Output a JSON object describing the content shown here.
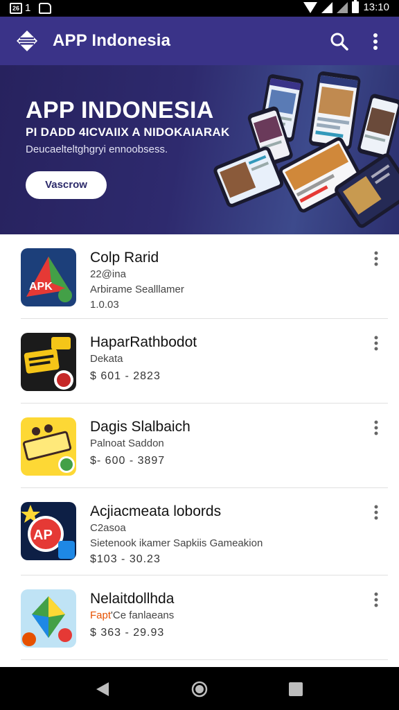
{
  "status_bar": {
    "left_badge": "26",
    "left_count": "1",
    "time": "13:10"
  },
  "app_bar": {
    "title": "APP Indonesia",
    "icons": [
      "app-logo-icon",
      "search-icon",
      "more-vert-icon"
    ]
  },
  "banner": {
    "title": "APP INDONESIA",
    "subtitle": "PI DADD 4ICVAIIX A NIDOKAIARAK",
    "description": "Deucaelteltghgryi ennoobsess.",
    "button_label": "Vascrow"
  },
  "apps": [
    {
      "name": "Colp Rarid",
      "line1": "22@ina",
      "line2": "Arbirame Sealllamer",
      "line3": "1.0.03",
      "icon": "app-triangle-icon",
      "icon_colors": [
        "#1c3f7a",
        "#e53935",
        "#43a047"
      ]
    },
    {
      "name": "HaparRathbodot",
      "line1": "Dekata",
      "price": "$ 601 - 2823",
      "icon": "app-badge-icon",
      "icon_colors": [
        "#1b1b1b",
        "#f5c518",
        "#c62828"
      ]
    },
    {
      "name": "Dagis Slalbaich",
      "line1": "Palnoat Saddon",
      "price": "$- 600 - 3897",
      "icon": "app-ticket-icon",
      "icon_colors": [
        "#fdd835",
        "#3e2723",
        "#43a047"
      ]
    },
    {
      "name": "Acjiacmeata  lobords",
      "line1": "C2asoa",
      "line2": "Sietenook ikamer Sapkiis Gameakion",
      "price": "$103 - 30.23",
      "icon": "app-ap-icon",
      "icon_colors": [
        "#0d1f45",
        "#e53935",
        "#1e88e5"
      ]
    },
    {
      "name": "Nelaitdollhda",
      "line1_accent": "Fapt",
      "line1_rest": "'Ce fanlaeans",
      "price": "$ 363 - 29.93",
      "icon": "app-kite-icon",
      "icon_colors": [
        "#bfe3f5",
        "#43a047",
        "#1e88e5"
      ]
    }
  ],
  "item_icons": [
    "more-vert-icon"
  ],
  "nav_bar": {
    "icons": [
      "back-icon",
      "home-icon",
      "recents-icon"
    ]
  },
  "colors": {
    "app_bar": "#3a3388",
    "banner": "#2e2a6e",
    "accent": "#e65100"
  }
}
